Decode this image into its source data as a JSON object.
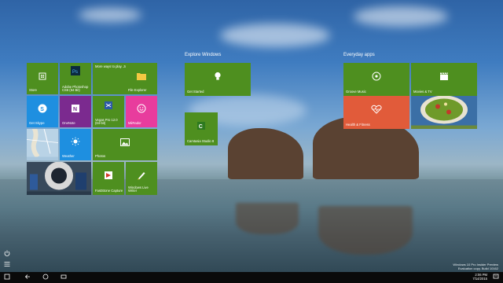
{
  "groups": {
    "left_title": "",
    "explore_title": "Explore Windows",
    "everyday_title": "Everyday apps"
  },
  "tiles": {
    "store": "Store",
    "photoshop": "Adobe Photoshop CS6 (64 Bit)",
    "more_ways": "More ways to play. Join us!",
    "file_explorer": "File Explorer",
    "get_skype": "Get Skype",
    "onenote": "OneNote",
    "vegas": "Vegas Pro 12.0 (64-bit)",
    "miirador": "MiiRador",
    "maps": "",
    "weather": "Weather",
    "photos": "Photos",
    "faststone": "FastStone Capture",
    "live_writer": "Windows Live Writer",
    "get_started": "Get Started",
    "camtasia": "Camtasia Studio 8",
    "groove": "Groove Music",
    "movies": "Movies & TV",
    "health": "Health & Fitness"
  },
  "watermark": {
    "line1": "Windows 10 Pro Insider Preview",
    "line2": "Evaluation copy. Build 10162"
  },
  "clock": {
    "time": "2:06 PM",
    "date": "7/14/2015"
  },
  "icons": {
    "power": "power-icon",
    "all_apps": "all-apps-icon",
    "back": "back-icon",
    "start": "start-icon",
    "task_view": "task-view-icon",
    "notifications": "notifications-icon"
  }
}
